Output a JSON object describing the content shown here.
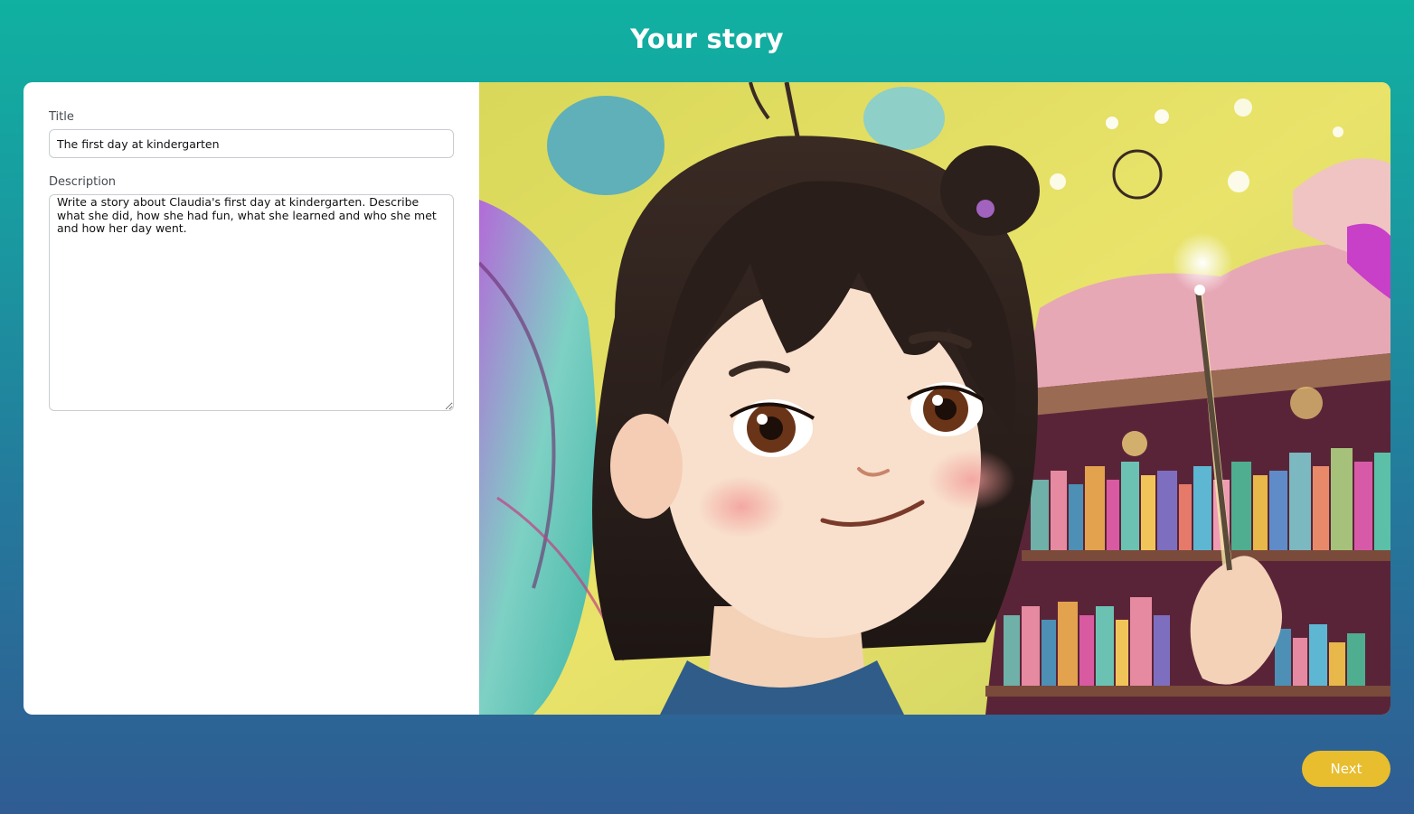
{
  "header": {
    "title": "Your story"
  },
  "form": {
    "title_label": "Title",
    "title_value": "The first day at kindergarten",
    "description_label": "Description",
    "description_value": "Write a story about Claudia's first day at kindergarten. Describe what she did, how she had fun, what she learned and who she met and how her day went."
  },
  "footer": {
    "next_label": "Next"
  },
  "colors": {
    "accent_button": "#e8bd2e",
    "gradient_top": "#10b1a1",
    "gradient_bottom": "#2f5c93"
  }
}
